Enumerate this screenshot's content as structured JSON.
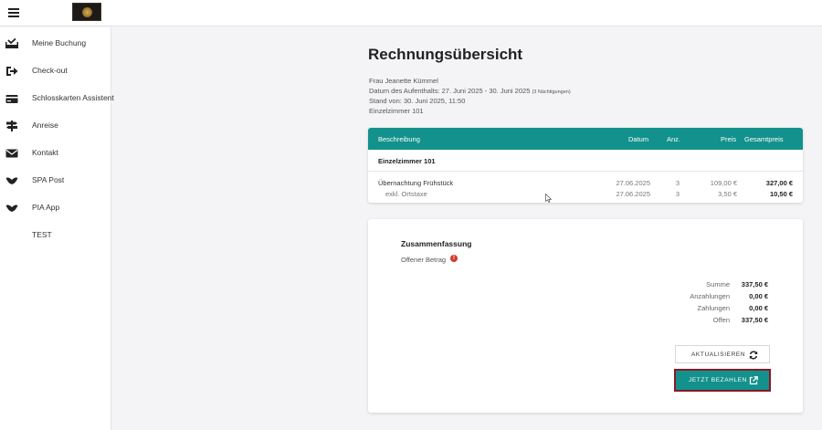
{
  "sidebar": {
    "items": [
      {
        "label": "Meine Buchung",
        "icon": "booking-icon"
      },
      {
        "label": "Check-out",
        "icon": "checkout-icon"
      },
      {
        "label": "Schlosskarten Assistent",
        "icon": "card-icon"
      },
      {
        "label": "Anreise",
        "icon": "signpost-icon"
      },
      {
        "label": "Kontakt",
        "icon": "mail-icon"
      },
      {
        "label": "SPA Post",
        "icon": "heart-icon"
      },
      {
        "label": "PIA App",
        "icon": "heart-icon"
      },
      {
        "label": "TEST",
        "icon": ""
      }
    ]
  },
  "page": {
    "title": "Rechnungsübersicht",
    "guest_name": "Frau Jeanette Kümmel",
    "stay_prefix": "Datum des Aufenthalts: 27. Juni 2025 - 30. Juni 2025",
    "stay_nights": "(3 Nächtigungen)",
    "status_date": "Stand von: 30. Juni 2025, 11:50",
    "room": "Einzelzimmer 101"
  },
  "invoice": {
    "headers": {
      "description": "Beschreibung",
      "date": "Datum",
      "qty": "Anz.",
      "price": "Preis",
      "total": "Gesamtpreis"
    },
    "group": "Einzelzimmer 101",
    "rows": [
      {
        "description": "Übernachtung Frühstück",
        "date": "27.06.2025",
        "qty": "3",
        "price": "109,00 €",
        "total": "327,00 €"
      },
      {
        "description": "exkl. Ortstaxe",
        "date": "27.06.2025",
        "qty": "3",
        "price": "3,50 €",
        "total": "10,50 €"
      }
    ]
  },
  "summary": {
    "title": "Zusammenfassung",
    "open_label": "Offener Betrag",
    "alert_mark": "!",
    "rows": [
      {
        "label": "Summe",
        "value": "337,50 €"
      },
      {
        "label": "Anzahlungen",
        "value": "0,00 €"
      },
      {
        "label": "Zahlungen",
        "value": "0,00 €"
      },
      {
        "label": "Offen",
        "value": "337,50 €"
      }
    ],
    "refresh_label": "AKTUALISIEREN",
    "pay_label": "JETZT BEZAHLEN"
  },
  "colors": {
    "accent": "#13918c",
    "highlight_border": "#8a1826",
    "alert": "#d23b2e"
  }
}
